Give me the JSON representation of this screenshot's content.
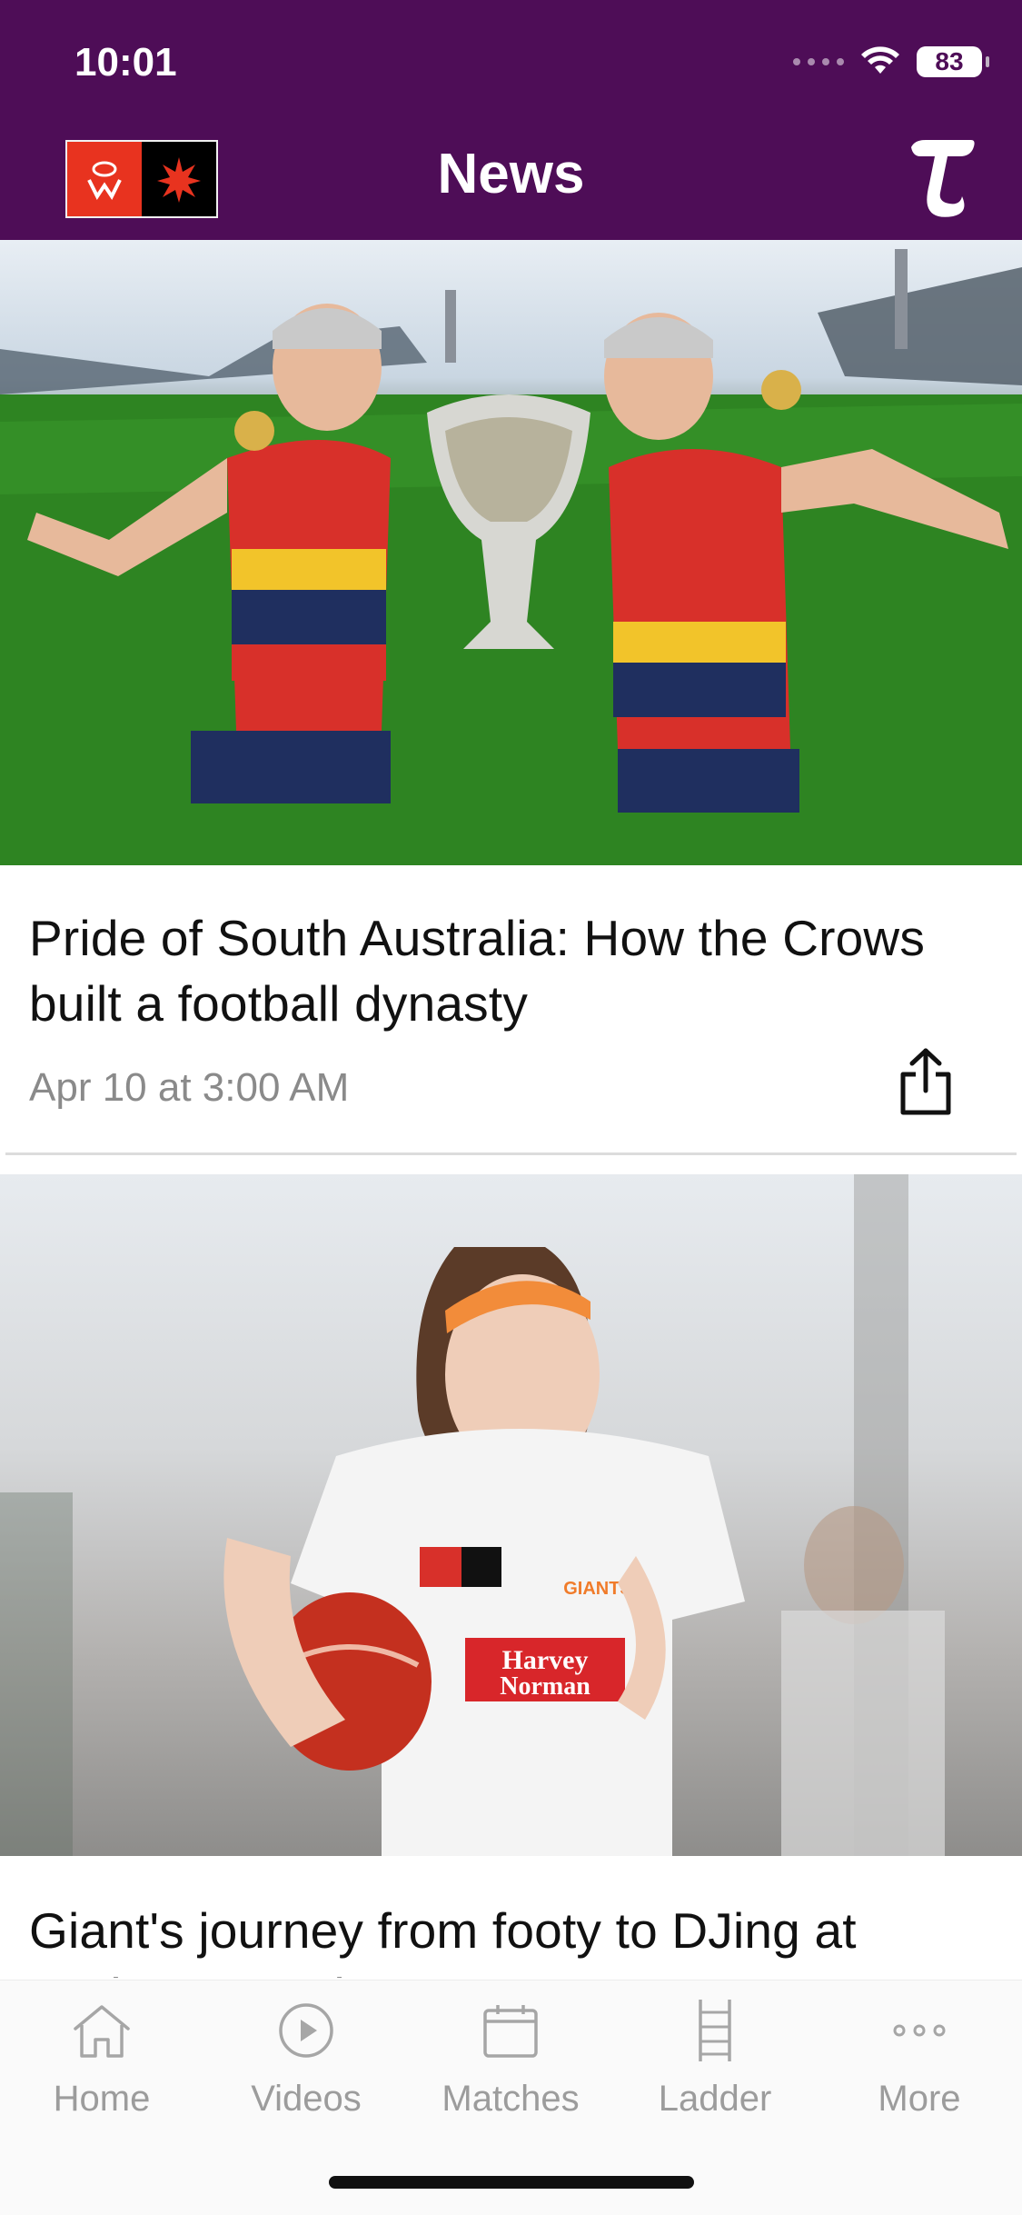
{
  "status_bar": {
    "time": "10:01",
    "battery": "83"
  },
  "header": {
    "title": "News",
    "logo_text": "AFLW"
  },
  "articles": [
    {
      "title": "Pride of South Australia: How the Crows built a football dynasty",
      "date": "Apr 10 at 3:00 AM"
    },
    {
      "title": "Giant's journey from footy to DJing at Gather Round"
    }
  ],
  "tabs": [
    {
      "label": "Home",
      "icon": "home-icon"
    },
    {
      "label": "Videos",
      "icon": "play-icon"
    },
    {
      "label": "Matches",
      "icon": "calendar-icon"
    },
    {
      "label": "Ladder",
      "icon": "ladder-icon"
    },
    {
      "label": "More",
      "icon": "more-icon"
    }
  ],
  "colors": {
    "header_bg": "#4e0d57",
    "afl_red": "#e8331f",
    "tab_gray": "#9c9c9c"
  }
}
